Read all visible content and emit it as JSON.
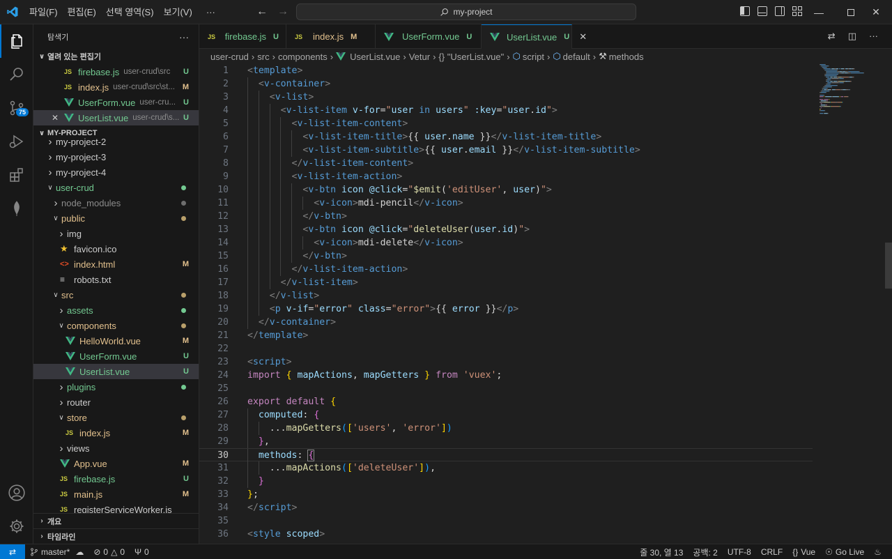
{
  "menu": [
    "파일(F)",
    "편집(E)",
    "선택 영역(S)",
    "보기(V)",
    "···"
  ],
  "search": {
    "text": "my-project"
  },
  "activity": {
    "badge": "75"
  },
  "sidebar": {
    "title": "탐색기",
    "more": "···",
    "open_editors": {
      "label": "열려 있는 편집기",
      "items": [
        {
          "icon": "js",
          "name": "firebase.js",
          "desc": "user-crud\\src",
          "status": "U"
        },
        {
          "icon": "js",
          "name": "index.js",
          "desc": "user-crud\\src\\st...",
          "status": "M"
        },
        {
          "icon": "vue",
          "name": "UserForm.vue",
          "desc": "user-cru...",
          "status": "U"
        },
        {
          "icon": "vue",
          "name": "UserList.vue",
          "desc": "user-crud\\s...",
          "status": "U"
        }
      ]
    },
    "project": {
      "label": "MY-PROJECT",
      "items": [
        {
          "kind": "folder",
          "open": false,
          "name": "my-project-2",
          "depth": 0,
          "status": ""
        },
        {
          "kind": "folder",
          "open": false,
          "name": "my-project-3",
          "depth": 0,
          "status": ""
        },
        {
          "kind": "folder",
          "open": false,
          "name": "my-project-4",
          "depth": 0,
          "status": ""
        },
        {
          "kind": "folder",
          "open": true,
          "name": "user-crud",
          "depth": 0,
          "status": "dot-green"
        },
        {
          "kind": "folder",
          "open": false,
          "name": "node_modules",
          "depth": 1,
          "status": "dot-gray"
        },
        {
          "kind": "folder",
          "open": true,
          "name": "public",
          "depth": 1,
          "status": "dot-yellow"
        },
        {
          "kind": "folder",
          "open": false,
          "name": "img",
          "depth": 2,
          "status": ""
        },
        {
          "kind": "star",
          "name": "favicon.ico",
          "depth": 2,
          "status": ""
        },
        {
          "kind": "html",
          "name": "index.html",
          "depth": 2,
          "status": "M"
        },
        {
          "kind": "txt",
          "name": "robots.txt",
          "depth": 2,
          "status": ""
        },
        {
          "kind": "folder",
          "open": true,
          "name": "src",
          "depth": 1,
          "status": "dot-yellow"
        },
        {
          "kind": "folder",
          "open": false,
          "name": "assets",
          "depth": 2,
          "status": "dot-green"
        },
        {
          "kind": "folder",
          "open": true,
          "name": "components",
          "depth": 2,
          "status": "dot-yellow"
        },
        {
          "kind": "vue",
          "name": "HelloWorld.vue",
          "depth": 3,
          "status": "M"
        },
        {
          "kind": "vue",
          "name": "UserForm.vue",
          "depth": 3,
          "status": "U"
        },
        {
          "kind": "vue",
          "name": "UserList.vue",
          "depth": 3,
          "status": "U",
          "selected": true
        },
        {
          "kind": "folder",
          "open": false,
          "name": "plugins",
          "depth": 2,
          "status": "dot-green"
        },
        {
          "kind": "folder",
          "open": false,
          "name": "router",
          "depth": 2,
          "status": ""
        },
        {
          "kind": "folder",
          "open": true,
          "name": "store",
          "depth": 2,
          "status": "dot-yellow"
        },
        {
          "kind": "js",
          "name": "index.js",
          "depth": 3,
          "status": "M"
        },
        {
          "kind": "folder",
          "open": false,
          "name": "views",
          "depth": 2,
          "status": ""
        },
        {
          "kind": "vue",
          "name": "App.vue",
          "depth": 2,
          "status": "M"
        },
        {
          "kind": "js",
          "name": "firebase.js",
          "depth": 2,
          "status": "U"
        },
        {
          "kind": "js",
          "name": "main.js",
          "depth": 2,
          "status": "M"
        },
        {
          "kind": "js",
          "name": "registerServiceWorker.js",
          "depth": 2,
          "status": ""
        }
      ]
    },
    "outline_label": "개요",
    "timeline_label": "타임라인"
  },
  "tabs": [
    {
      "icon": "js",
      "label": "firebase.js",
      "status": "U"
    },
    {
      "icon": "js",
      "label": "index.js",
      "status": "M"
    },
    {
      "icon": "vue",
      "label": "UserForm.vue",
      "status": "U"
    },
    {
      "icon": "vue",
      "label": "UserList.vue",
      "status": "U",
      "active": true
    }
  ],
  "breadcrumb": [
    "user-crud",
    "src",
    "components",
    "UserList.vue",
    "Vetur",
    "{} \"UserList.vue\"",
    "script",
    "default",
    "methods"
  ],
  "editor": {
    "current_line": 30,
    "lines": [
      [
        [
          "tg",
          "<"
        ],
        [
          "tn",
          "template"
        ],
        [
          "tg",
          ">"
        ]
      ],
      [
        [
          "tx",
          "  "
        ],
        [
          "tg",
          "<"
        ],
        [
          "tn",
          "v-container"
        ],
        [
          "tg",
          ">"
        ]
      ],
      [
        [
          "tx",
          "    "
        ],
        [
          "tg",
          "<"
        ],
        [
          "tn",
          "v-list"
        ],
        [
          "tg",
          ">"
        ]
      ],
      [
        [
          "tx",
          "      "
        ],
        [
          "tg",
          "<"
        ],
        [
          "tn",
          "v-list-item"
        ],
        [
          "tx",
          " "
        ],
        [
          "at",
          "v-for"
        ],
        [
          "tx",
          "="
        ],
        [
          "st",
          "\""
        ],
        [
          "at",
          "user"
        ],
        [
          "tx",
          " "
        ],
        [
          "tn",
          "in"
        ],
        [
          "tx",
          " "
        ],
        [
          "at",
          "users"
        ],
        [
          "st",
          "\""
        ],
        [
          "tx",
          " "
        ],
        [
          "at",
          ":key"
        ],
        [
          "tx",
          "="
        ],
        [
          "st",
          "\""
        ],
        [
          "at",
          "user"
        ],
        [
          "tx",
          "."
        ],
        [
          "at",
          "id"
        ],
        [
          "st",
          "\""
        ],
        [
          "tg",
          ">"
        ]
      ],
      [
        [
          "tx",
          "        "
        ],
        [
          "tg",
          "<"
        ],
        [
          "tn",
          "v-list-item-content"
        ],
        [
          "tg",
          ">"
        ]
      ],
      [
        [
          "tx",
          "          "
        ],
        [
          "tg",
          "<"
        ],
        [
          "tn",
          "v-list-item-title"
        ],
        [
          "tg",
          ">"
        ],
        [
          "tx",
          "{{ "
        ],
        [
          "at",
          "user"
        ],
        [
          "tx",
          "."
        ],
        [
          "at",
          "name"
        ],
        [
          "tx",
          " }}"
        ],
        [
          "tg",
          "</"
        ],
        [
          "tn",
          "v-list-item-title"
        ],
        [
          "tg",
          ">"
        ]
      ],
      [
        [
          "tx",
          "          "
        ],
        [
          "tg",
          "<"
        ],
        [
          "tn",
          "v-list-item-subtitle"
        ],
        [
          "tg",
          ">"
        ],
        [
          "tx",
          "{{ "
        ],
        [
          "at",
          "user"
        ],
        [
          "tx",
          "."
        ],
        [
          "at",
          "email"
        ],
        [
          "tx",
          " }}"
        ],
        [
          "tg",
          "</"
        ],
        [
          "tn",
          "v-list-item-subtitle"
        ],
        [
          "tg",
          ">"
        ]
      ],
      [
        [
          "tx",
          "        "
        ],
        [
          "tg",
          "</"
        ],
        [
          "tn",
          "v-list-item-content"
        ],
        [
          "tg",
          ">"
        ]
      ],
      [
        [
          "tx",
          "        "
        ],
        [
          "tg",
          "<"
        ],
        [
          "tn",
          "v-list-item-action"
        ],
        [
          "tg",
          ">"
        ]
      ],
      [
        [
          "tx",
          "          "
        ],
        [
          "tg",
          "<"
        ],
        [
          "tn",
          "v-btn"
        ],
        [
          "tx",
          " "
        ],
        [
          "at",
          "icon"
        ],
        [
          "tx",
          " "
        ],
        [
          "at",
          "@click"
        ],
        [
          "tx",
          "="
        ],
        [
          "st",
          "\""
        ],
        [
          "fn",
          "$emit"
        ],
        [
          "tx",
          "("
        ],
        [
          "st",
          "'editUser'"
        ],
        [
          "tx",
          ", "
        ],
        [
          "at",
          "user"
        ],
        [
          "tx",
          ")"
        ],
        [
          "st",
          "\""
        ],
        [
          "tg",
          ">"
        ]
      ],
      [
        [
          "tx",
          "            "
        ],
        [
          "tg",
          "<"
        ],
        [
          "tn",
          "v-icon"
        ],
        [
          "tg",
          ">"
        ],
        [
          "tx",
          "mdi-pencil"
        ],
        [
          "tg",
          "</"
        ],
        [
          "tn",
          "v-icon"
        ],
        [
          "tg",
          ">"
        ]
      ],
      [
        [
          "tx",
          "          "
        ],
        [
          "tg",
          "</"
        ],
        [
          "tn",
          "v-btn"
        ],
        [
          "tg",
          ">"
        ]
      ],
      [
        [
          "tx",
          "          "
        ],
        [
          "tg",
          "<"
        ],
        [
          "tn",
          "v-btn"
        ],
        [
          "tx",
          " "
        ],
        [
          "at",
          "icon"
        ],
        [
          "tx",
          " "
        ],
        [
          "at",
          "@click"
        ],
        [
          "tx",
          "="
        ],
        [
          "st",
          "\""
        ],
        [
          "fn",
          "deleteUser"
        ],
        [
          "tx",
          "("
        ],
        [
          "at",
          "user"
        ],
        [
          "tx",
          "."
        ],
        [
          "at",
          "id"
        ],
        [
          "tx",
          ")"
        ],
        [
          "st",
          "\""
        ],
        [
          "tg",
          ">"
        ]
      ],
      [
        [
          "tx",
          "            "
        ],
        [
          "tg",
          "<"
        ],
        [
          "tn",
          "v-icon"
        ],
        [
          "tg",
          ">"
        ],
        [
          "tx",
          "mdi-delete"
        ],
        [
          "tg",
          "</"
        ],
        [
          "tn",
          "v-icon"
        ],
        [
          "tg",
          ">"
        ]
      ],
      [
        [
          "tx",
          "          "
        ],
        [
          "tg",
          "</"
        ],
        [
          "tn",
          "v-btn"
        ],
        [
          "tg",
          ">"
        ]
      ],
      [
        [
          "tx",
          "        "
        ],
        [
          "tg",
          "</"
        ],
        [
          "tn",
          "v-list-item-action"
        ],
        [
          "tg",
          ">"
        ]
      ],
      [
        [
          "tx",
          "      "
        ],
        [
          "tg",
          "</"
        ],
        [
          "tn",
          "v-list-item"
        ],
        [
          "tg",
          ">"
        ]
      ],
      [
        [
          "tx",
          "    "
        ],
        [
          "tg",
          "</"
        ],
        [
          "tn",
          "v-list"
        ],
        [
          "tg",
          ">"
        ]
      ],
      [
        [
          "tx",
          "    "
        ],
        [
          "tg",
          "<"
        ],
        [
          "tn",
          "p"
        ],
        [
          "tx",
          " "
        ],
        [
          "at",
          "v-if"
        ],
        [
          "tx",
          "="
        ],
        [
          "st",
          "\""
        ],
        [
          "at",
          "error"
        ],
        [
          "st",
          "\""
        ],
        [
          "tx",
          " "
        ],
        [
          "at",
          "class"
        ],
        [
          "tx",
          "="
        ],
        [
          "st",
          "\"error\""
        ],
        [
          "tg",
          ">"
        ],
        [
          "tx",
          "{{ "
        ],
        [
          "at",
          "error"
        ],
        [
          "tx",
          " }}"
        ],
        [
          "tg",
          "</"
        ],
        [
          "tn",
          "p"
        ],
        [
          "tg",
          ">"
        ]
      ],
      [
        [
          "tx",
          "  "
        ],
        [
          "tg",
          "</"
        ],
        [
          "tn",
          "v-container"
        ],
        [
          "tg",
          ">"
        ]
      ],
      [
        [
          "tg",
          "</"
        ],
        [
          "tn",
          "template"
        ],
        [
          "tg",
          ">"
        ]
      ],
      [],
      [
        [
          "tg",
          "<"
        ],
        [
          "tn",
          "script"
        ],
        [
          "tg",
          ">"
        ]
      ],
      [
        [
          "kw",
          "import"
        ],
        [
          "tx",
          " "
        ],
        [
          "b1",
          "{"
        ],
        [
          "tx",
          " "
        ],
        [
          "pr",
          "mapActions"
        ],
        [
          "tx",
          ", "
        ],
        [
          "pr",
          "mapGetters"
        ],
        [
          "tx",
          " "
        ],
        [
          "b1",
          "}"
        ],
        [
          "tx",
          " "
        ],
        [
          "kw",
          "from"
        ],
        [
          "tx",
          " "
        ],
        [
          "st",
          "'vuex'"
        ],
        [
          "tx",
          ";"
        ]
      ],
      [],
      [
        [
          "kw",
          "export"
        ],
        [
          "tx",
          " "
        ],
        [
          "kw",
          "default"
        ],
        [
          "tx",
          " "
        ],
        [
          "b1",
          "{"
        ]
      ],
      [
        [
          "tx",
          "  "
        ],
        [
          "pr",
          "computed"
        ],
        [
          "tx",
          ": "
        ],
        [
          "b2",
          "{"
        ]
      ],
      [
        [
          "tx",
          "    ..."
        ],
        [
          "fn",
          "mapGetters"
        ],
        [
          "b3",
          "("
        ],
        [
          "b1",
          "["
        ],
        [
          "st",
          "'users'"
        ],
        [
          "tx",
          ", "
        ],
        [
          "st",
          "'error'"
        ],
        [
          "b1",
          "]"
        ],
        [
          "b3",
          ")"
        ]
      ],
      [
        [
          "tx",
          "  "
        ],
        [
          "b2",
          "}"
        ],
        [
          "tx",
          ","
        ]
      ],
      [
        [
          "tx",
          "  "
        ],
        [
          "pr",
          "methods"
        ],
        [
          "tx",
          ": "
        ],
        [
          "b2",
          "{"
        ]
      ],
      [
        [
          "tx",
          "    ..."
        ],
        [
          "fn",
          "mapActions"
        ],
        [
          "b3",
          "("
        ],
        [
          "b1",
          "["
        ],
        [
          "st",
          "'deleteUser'"
        ],
        [
          "b1",
          "]"
        ],
        [
          "b3",
          ")"
        ],
        [
          "tx",
          ","
        ]
      ],
      [
        [
          "tx",
          "  "
        ],
        [
          "b2",
          "}"
        ]
      ],
      [
        [
          "b1",
          "}"
        ],
        [
          "tx",
          ";"
        ]
      ],
      [
        [
          "tg",
          "</"
        ],
        [
          "tn",
          "script"
        ],
        [
          "tg",
          ">"
        ]
      ],
      [],
      [
        [
          "tg",
          "<"
        ],
        [
          "tn",
          "style"
        ],
        [
          "tx",
          " "
        ],
        [
          "at",
          "scoped"
        ],
        [
          "tg",
          ">"
        ]
      ]
    ]
  },
  "status": {
    "branch": "master*",
    "errors": "0",
    "warnings": "0",
    "ports": "0",
    "position": "줄 30, 열 13",
    "spaces": "공백: 2",
    "encoding": "UTF-8",
    "eol": "CRLF",
    "language": "Vue",
    "golive": "Go Live"
  },
  "colors": {
    "accent": "#0078d4",
    "modified": "#e2c08d",
    "untracked": "#73c991",
    "vue": "#41b883",
    "js": "#cbcb41"
  }
}
